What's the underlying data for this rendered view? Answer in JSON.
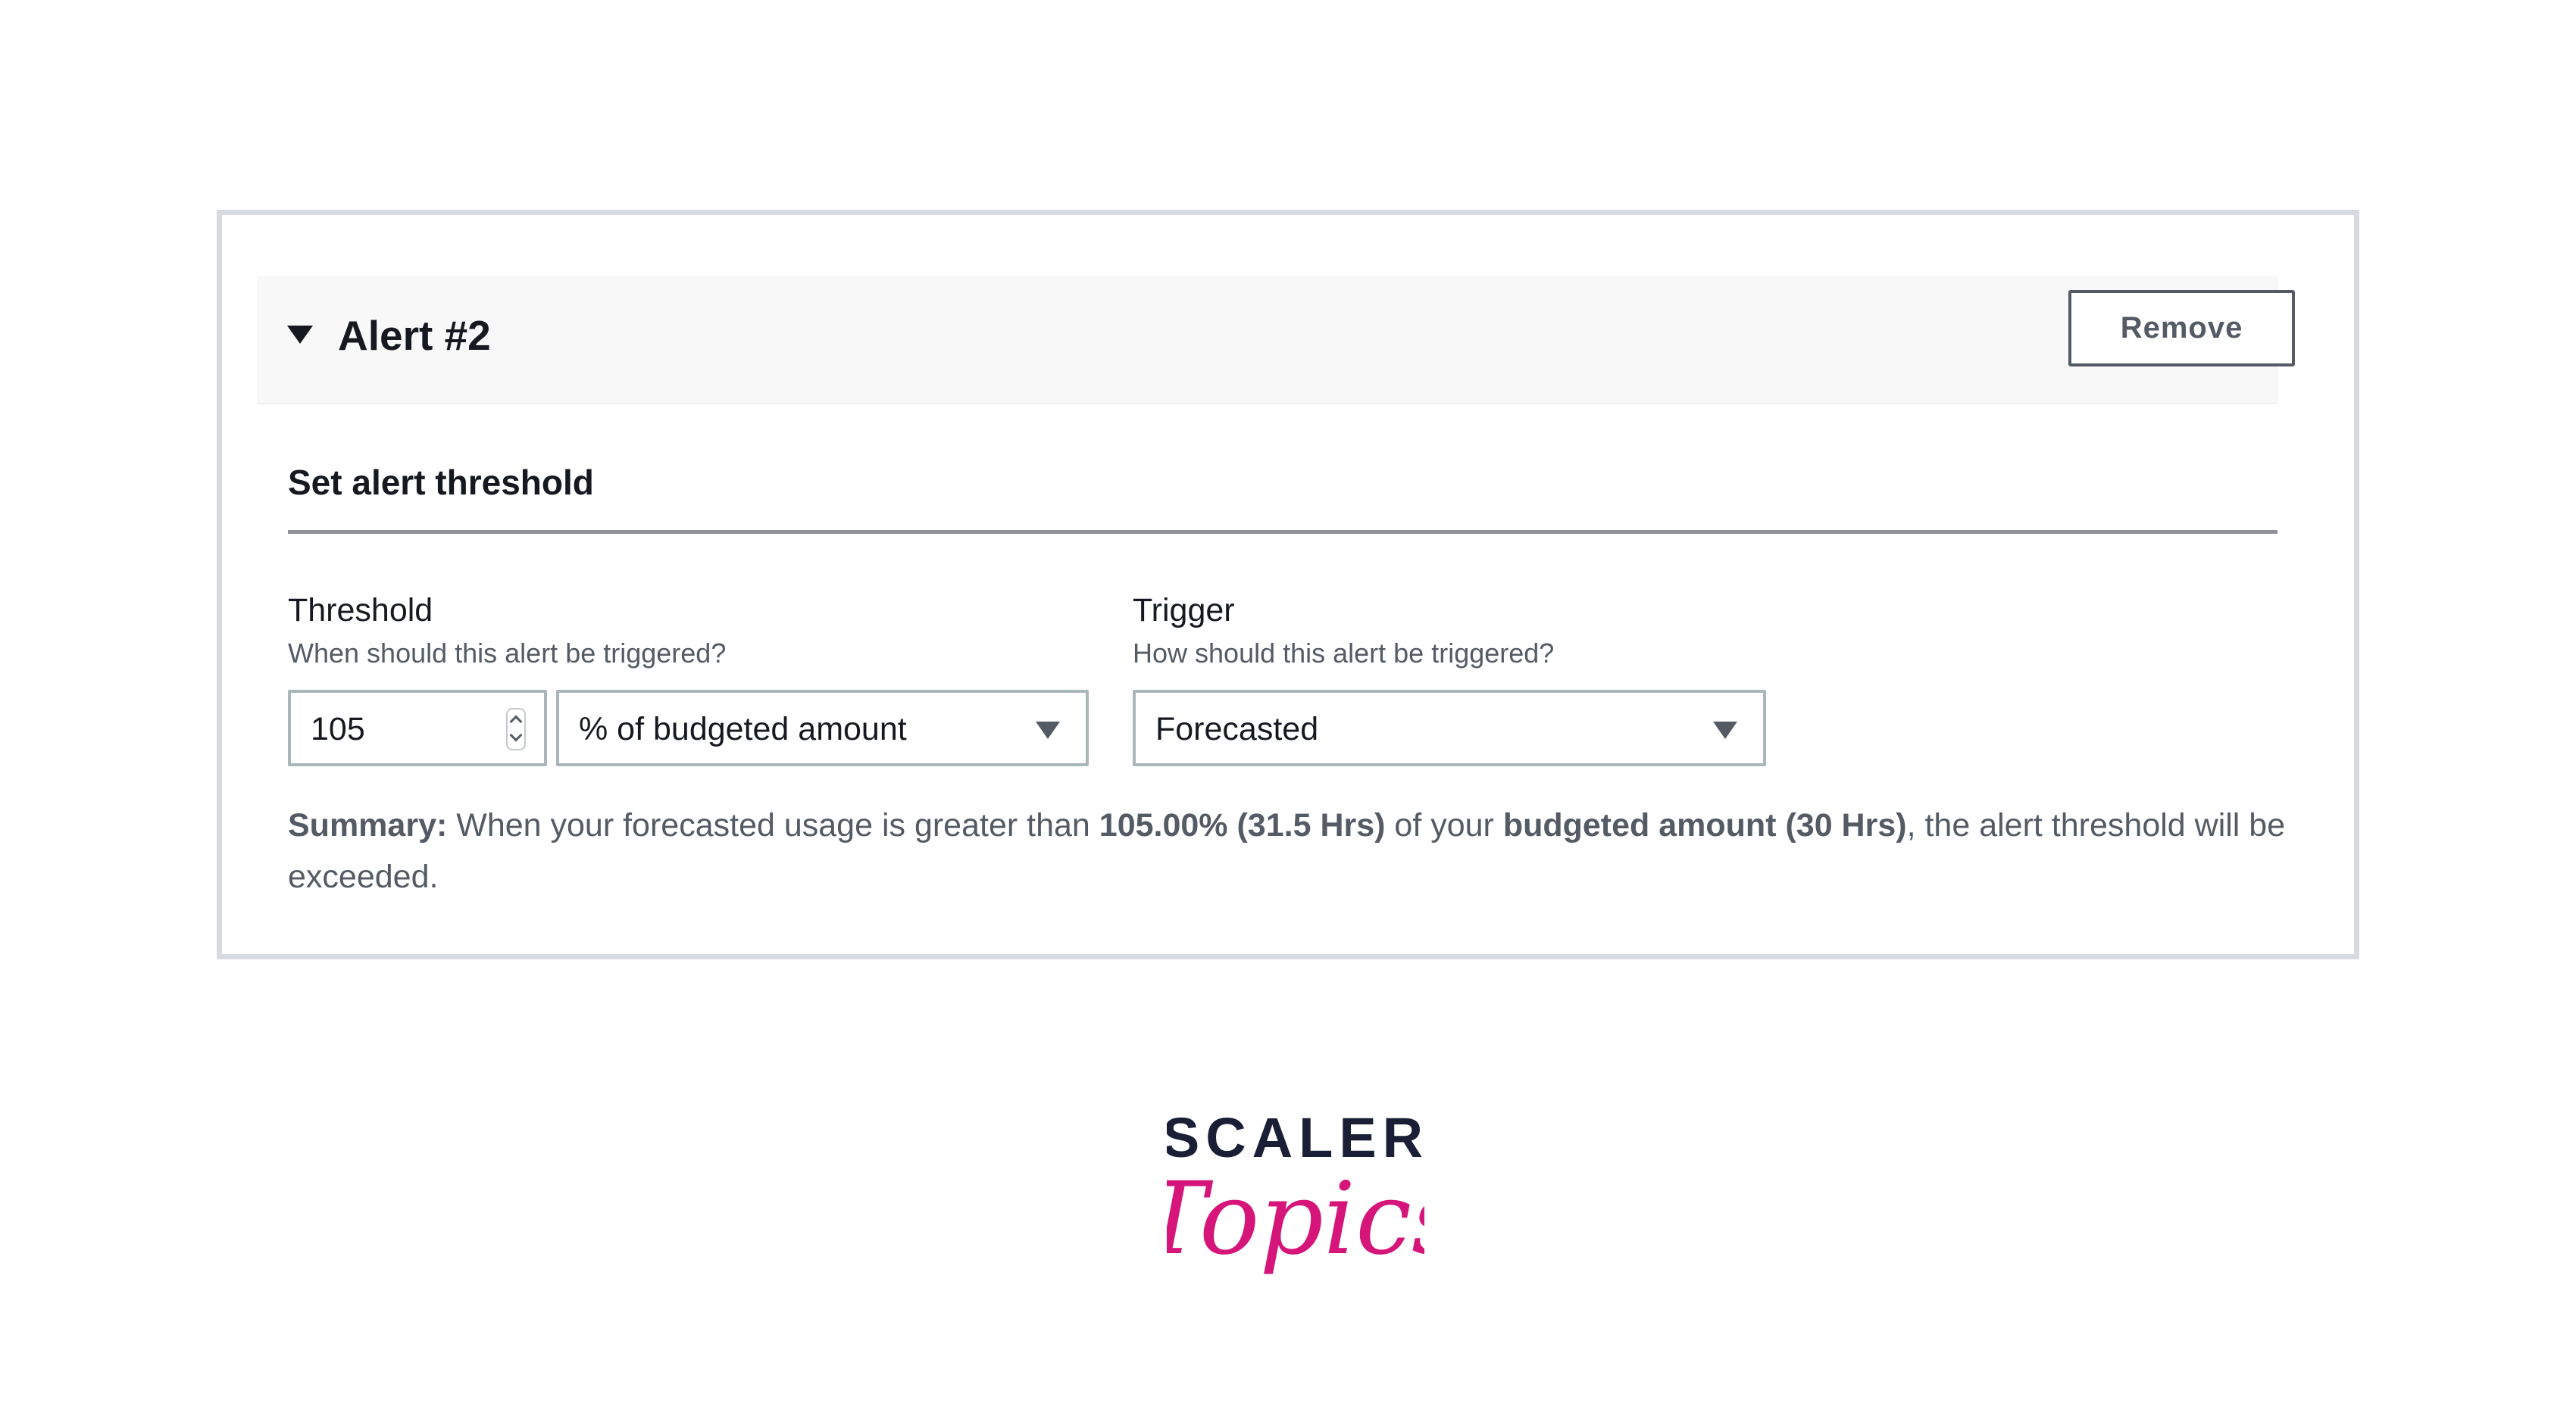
{
  "alert": {
    "title": "Alert #2",
    "remove_label": "Remove"
  },
  "section": {
    "title": "Set alert threshold"
  },
  "threshold": {
    "label": "Threshold",
    "description": "When should this alert be triggered?",
    "value": "105",
    "unit": "% of budgeted amount"
  },
  "trigger": {
    "label": "Trigger",
    "description": "How should this alert be triggered?",
    "value": "Forecasted"
  },
  "summary": {
    "prefix": "Summary:",
    "part1": " When your forecasted usage is greater than ",
    "threshold_value": "105.00% (31.5 Hrs)",
    "part2": " of your ",
    "budget_value": "budgeted amount (30 Hrs)",
    "part3": ", the alert threshold will be exceeded."
  },
  "logo": {
    "line1": "SCALER",
    "line2": "Topics"
  },
  "colors": {
    "text_primary": "#16191f",
    "text_secondary": "#545b64",
    "border": "#aab7b8",
    "frame": "#d6dbe1",
    "header_bg": "#f8f8f9",
    "logo_navy": "#1a1f36",
    "logo_pink": "#d6157b"
  },
  "icons": {
    "expand": "caret-down-icon",
    "stepper": "stepper-icon",
    "dropdown": "dropdown-caret-icon"
  }
}
